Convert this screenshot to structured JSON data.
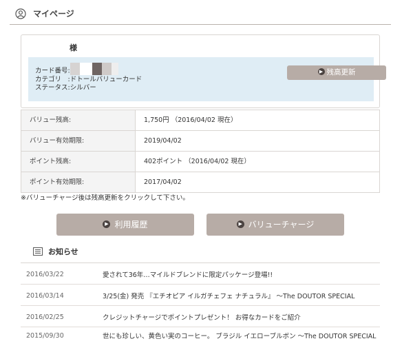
{
  "header": {
    "title": "マイページ"
  },
  "card": {
    "sama": "様",
    "card_number_label": "カード番号:",
    "category": "カテゴリ　:ドトールバリューカード",
    "status": "ステータス:シルバー",
    "refresh_button": "残高更新"
  },
  "table": {
    "rows": [
      {
        "label": "バリュー残高:",
        "value": "1,750円 （2016/04/02 現在）"
      },
      {
        "label": "バリュー有効期限:",
        "value": "2019/04/02"
      },
      {
        "label": "ポイント残高:",
        "value": "402ポイント （2016/04/02 現在）"
      },
      {
        "label": "ポイント有効期限:",
        "value": "2017/04/02"
      }
    ]
  },
  "note": "※バリューチャージ後は残高更新をクリックして下さい。",
  "buttons": {
    "history": "利用履歴",
    "charge": "バリューチャージ"
  },
  "news": {
    "heading": "お知らせ",
    "items": [
      {
        "date": "2016/03/22",
        "title": "愛されて36年…マイルドブレンドに限定パッケージ登場!!"
      },
      {
        "date": "2016/03/14",
        "title": "3/25(金) 発売 『エチオピア イルガチェフェ ナチュラル』 ～The DOUTOR SPECIAL"
      },
      {
        "date": "2016/02/25",
        "title": "クレジットチャージでポイントプレゼント！ お得なカードをご紹介"
      },
      {
        "date": "2015/09/30",
        "title": "世にも珍しい、黄色い実のコーヒー。 ブラジル イエローブルボン ～The DOUTOR SPECIAL"
      }
    ]
  },
  "colors": {
    "button_bg": "#b7aca6",
    "info_bg": "#dfedf5",
    "label_bg": "#f4f4f4"
  }
}
